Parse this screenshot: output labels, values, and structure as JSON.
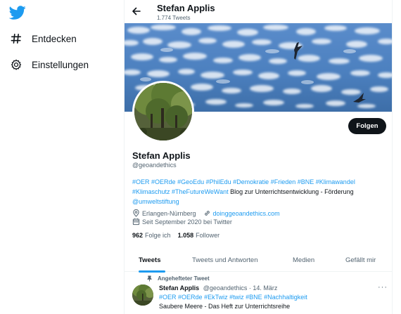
{
  "sidebar": {
    "logo_icon": "twitter-bird-icon",
    "items": [
      {
        "icon": "hashtag-icon",
        "label": "Entdecken"
      },
      {
        "icon": "gear-icon",
        "label": "Einstellungen"
      }
    ]
  },
  "header": {
    "title": "Stefan Applis",
    "tweet_count": "1.774 Tweets"
  },
  "profile": {
    "follow_label": "Folgen",
    "name": "Stefan Applis",
    "handle": "@geoandethics",
    "bio": {
      "line1_tags": [
        "#OER",
        "#OERde",
        "#GeoEdu",
        "#PhilEdu",
        "#Demokratie",
        "#Frieden",
        "#BNE",
        "#Klimawandel"
      ],
      "line2_tags": [
        "#Klimaschutz",
        "#TheFutureWeWant"
      ],
      "line2_text": "Blog zur Unterrichtsentwicklung - Förderung",
      "line3_mention": "@umweltstiftung"
    },
    "location": "Erlangen-Nürnberg",
    "website": "doinggeoandethics.com",
    "joined": "Seit September 2020 bei Twitter",
    "following_count": "962",
    "following_label": "Folge ich",
    "followers_count": "1.058",
    "followers_label": "Follower"
  },
  "tabs": [
    {
      "label": "Tweets",
      "active": true
    },
    {
      "label": "Tweets und Antworten",
      "active": false
    },
    {
      "label": "Medien",
      "active": false
    },
    {
      "label": "Gefällt mir",
      "active": false
    }
  ],
  "pinned_tweet": {
    "pinned_label": "Angehefteter Tweet",
    "author_name": "Stefan Applis",
    "author_handle": "@geoandethics",
    "separator": "·",
    "date": "14. März",
    "more_label": "···",
    "tags": [
      "#OER",
      "#OERde",
      "#EkTwiz",
      "#twiz",
      "#BNE",
      "#Nachhaltigkeit"
    ],
    "text": "Saubere Meere - Das Heft zur Unterrichtsreihe"
  },
  "colors": {
    "accent": "#1d9bf0",
    "text": "#0f1419",
    "muted": "#536471",
    "sky": "#4b7fb8"
  }
}
